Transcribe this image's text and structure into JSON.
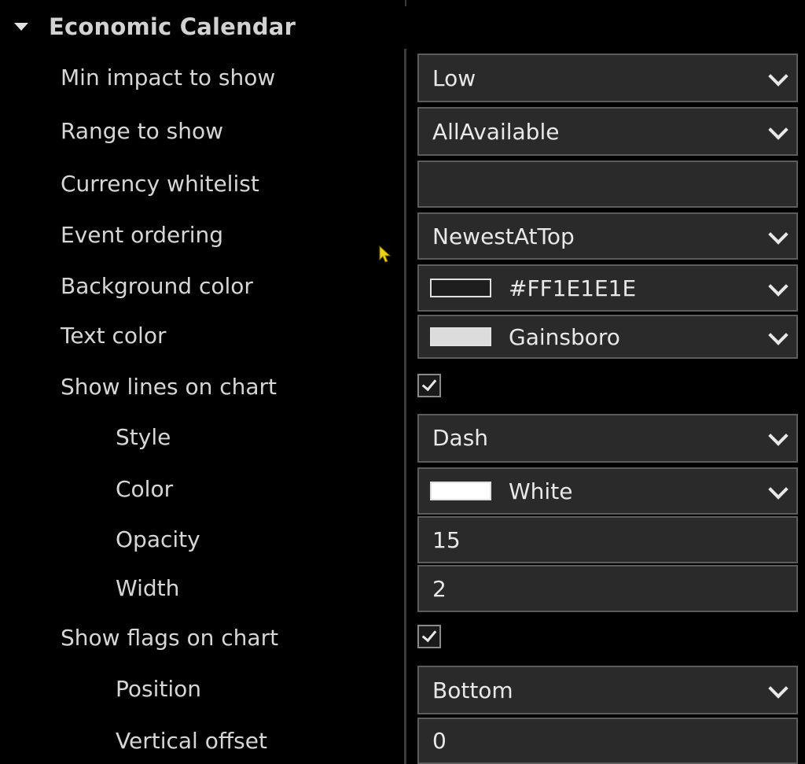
{
  "section": {
    "title": "Economic Calendar"
  },
  "fields": {
    "min_impact": {
      "label": "Min impact to show",
      "value": "Low"
    },
    "range": {
      "label": "Range to show",
      "value": "AllAvailable"
    },
    "currency_whitelist": {
      "label": "Currency whitelist",
      "value": ""
    },
    "event_ordering": {
      "label": "Event ordering",
      "value": "NewestAtTop"
    },
    "background_color": {
      "label": "Background color",
      "value": "#FF1E1E1E",
      "swatch": "#1e1e1e"
    },
    "text_color": {
      "label": "Text color",
      "value": "Gainsboro",
      "swatch": "#dcdcdc"
    },
    "show_lines": {
      "label": "Show lines on chart",
      "checked": true
    },
    "line_style": {
      "label": "Style",
      "value": "Dash"
    },
    "line_color": {
      "label": "Color",
      "value": "White",
      "swatch": "#ffffff"
    },
    "line_opacity": {
      "label": "Opacity",
      "value": "15"
    },
    "line_width": {
      "label": "Width",
      "value": "2"
    },
    "show_flags": {
      "label": "Show flags on chart",
      "checked": true
    },
    "flag_position": {
      "label": "Position",
      "value": "Bottom"
    },
    "vertical_offset": {
      "label": "Vertical offset",
      "value": "0"
    }
  },
  "icons": {
    "collapse": "triangle-down-icon",
    "dropdown": "chevron-down-icon",
    "checkmark": "check-icon",
    "cursor": "mouse-pointer-icon"
  },
  "colors": {
    "background": "#000000",
    "control_bg": "#2a2a2a",
    "control_border": "#5c5c5c",
    "cursor": "#e8d21a"
  }
}
